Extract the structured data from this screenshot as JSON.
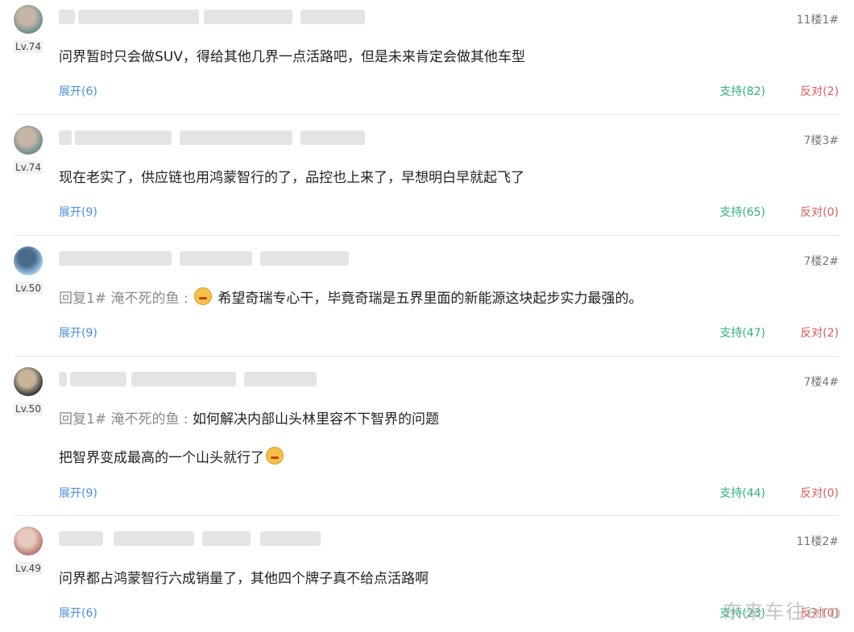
{
  "labels": {
    "expand_prefix": "展开",
    "support_prefix": "支持",
    "oppose_prefix": "反对"
  },
  "comments": [
    {
      "level": "Lv.74",
      "floor": "11楼1#",
      "reply_prefix": "",
      "text": "问界暂时只会做SUV，得给其他几界一点活路吧，但是未来肯定会做其他车型",
      "second_line": "",
      "expand": "展开(6)",
      "support": "支持(82)",
      "oppose": "反对(2)",
      "avatar_colors": [
        "#6f8f90",
        "#c7b6a6"
      ]
    },
    {
      "level": "Lv.74",
      "floor": "7楼3#",
      "reply_prefix": "",
      "text": "现在老实了，供应链也用鸿蒙智行的了，品控也上来了，早想明白早就起飞了",
      "second_line": "",
      "expand": "展开(9)",
      "support": "支持(65)",
      "oppose": "反对(0)",
      "avatar_colors": [
        "#6f8f90",
        "#c7b6a6"
      ]
    },
    {
      "level": "Lv.50",
      "floor": "7楼2#",
      "reply_prefix": "回复1#  淹不死的鱼 :",
      "text": "希望奇瑞专心干，毕竟奇瑞是五界里面的新能源这块起步实力最强的。",
      "second_line": "",
      "expand": "展开(9)",
      "support": "支持(47)",
      "oppose": "反对(2)",
      "avatar_colors": [
        "#9cc8e8",
        "#4a6a8c"
      ]
    },
    {
      "level": "Lv.50",
      "floor": "7楼4#",
      "reply_prefix": "回复1#  淹不死的鱼 :",
      "text": "如何解决内部山头林里容不下智界的问题",
      "second_line": "把智界变成最高的一个山头就行了",
      "expand": "展开(9)",
      "support": "支持(44)",
      "oppose": "反对(0)",
      "avatar_colors": [
        "#3a3a3a",
        "#c9b49a"
      ]
    },
    {
      "level": "Lv.49",
      "floor": "11楼2#",
      "reply_prefix": "",
      "text": "问界都占鸿蒙智行六成销量了，其他四个牌子真不给点活路啊",
      "second_line": "",
      "expand": "展开(6)",
      "support": "支持(23)",
      "oppose": "反对(0)",
      "avatar_colors": [
        "#b97a72",
        "#e6c9bf"
      ]
    }
  ],
  "watermark": "东来车往ero"
}
